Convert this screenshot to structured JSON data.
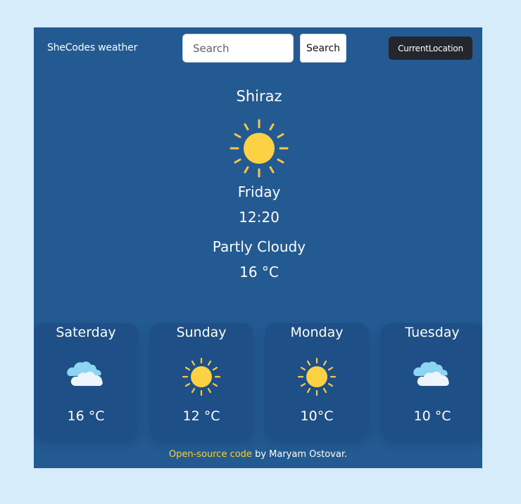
{
  "header": {
    "brand": "SheCodes weather",
    "search_placeholder": "Search",
    "search_button": "Search",
    "location_button": "CurrentLocation"
  },
  "current": {
    "city": "Shiraz",
    "icon": "sun-icon",
    "day": "Friday",
    "time": "12:20",
    "description": "Partly Cloudy",
    "temperature": "16 °C"
  },
  "forecast": [
    {
      "day": "Saterday",
      "icon": "cloud-icon",
      "temp": "16 °C"
    },
    {
      "day": "Sunday",
      "icon": "sun-icon",
      "temp": "12 °C"
    },
    {
      "day": "Monday",
      "icon": "sun-icon",
      "temp": "10°C"
    },
    {
      "day": "Tuesday",
      "icon": "cloud-icon",
      "temp": "10 °C"
    }
  ],
  "footer": {
    "link_text": "Open-source code",
    "suffix": " by Maryam Ostovar."
  },
  "colors": {
    "page_background": "#d6ecfb",
    "app_background": "#235a92",
    "card_background": "#1e4f86",
    "accent": "#f7d23a"
  }
}
